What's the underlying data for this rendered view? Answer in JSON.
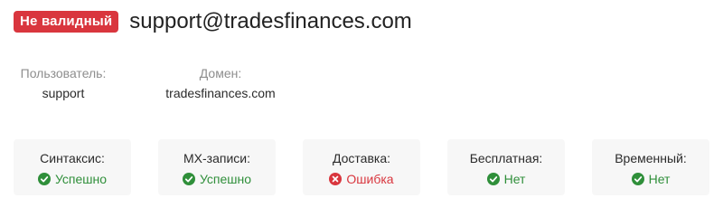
{
  "header": {
    "status_badge": "Не валидный",
    "email": "support@tradesfinances.com"
  },
  "info": {
    "user": {
      "label": "Пользователь:",
      "value": "support"
    },
    "domain": {
      "label": "Домен:",
      "value": "tradesfinances.com"
    }
  },
  "checks": [
    {
      "title": "Синтаксис:",
      "result": "Успешно",
      "status": "ok",
      "icon": "check-circle-icon"
    },
    {
      "title": "MX-записи:",
      "result": "Успешно",
      "status": "ok",
      "icon": "check-circle-icon"
    },
    {
      "title": "Доставка:",
      "result": "Ошибка",
      "status": "error",
      "icon": "x-circle-icon"
    },
    {
      "title": "Бесплатная:",
      "result": "Нет",
      "status": "ok",
      "icon": "check-circle-icon"
    },
    {
      "title": "Временный:",
      "result": "Нет",
      "status": "ok",
      "icon": "check-circle-icon"
    }
  ],
  "colors": {
    "badge_bg": "#d9363e",
    "success": "#2f8f3a",
    "error": "#d9363e",
    "card_bg": "#f7f7f7"
  }
}
